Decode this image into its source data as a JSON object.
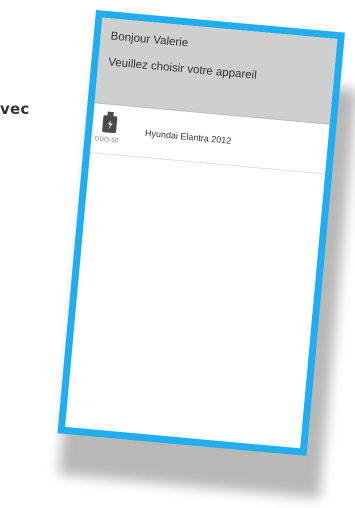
{
  "background": {
    "partial_text": "vec"
  },
  "header": {
    "greeting": "Bonjour Valerie",
    "prompt": "Veuillez choisir votre appareil"
  },
  "devices": [
    {
      "code": "ODO-50",
      "name": "Hyundai Elantra 2012",
      "icon": "obd-dongle-icon"
    }
  ],
  "colors": {
    "frame": "#21aef0",
    "header_bg": "#cfcfcf"
  }
}
